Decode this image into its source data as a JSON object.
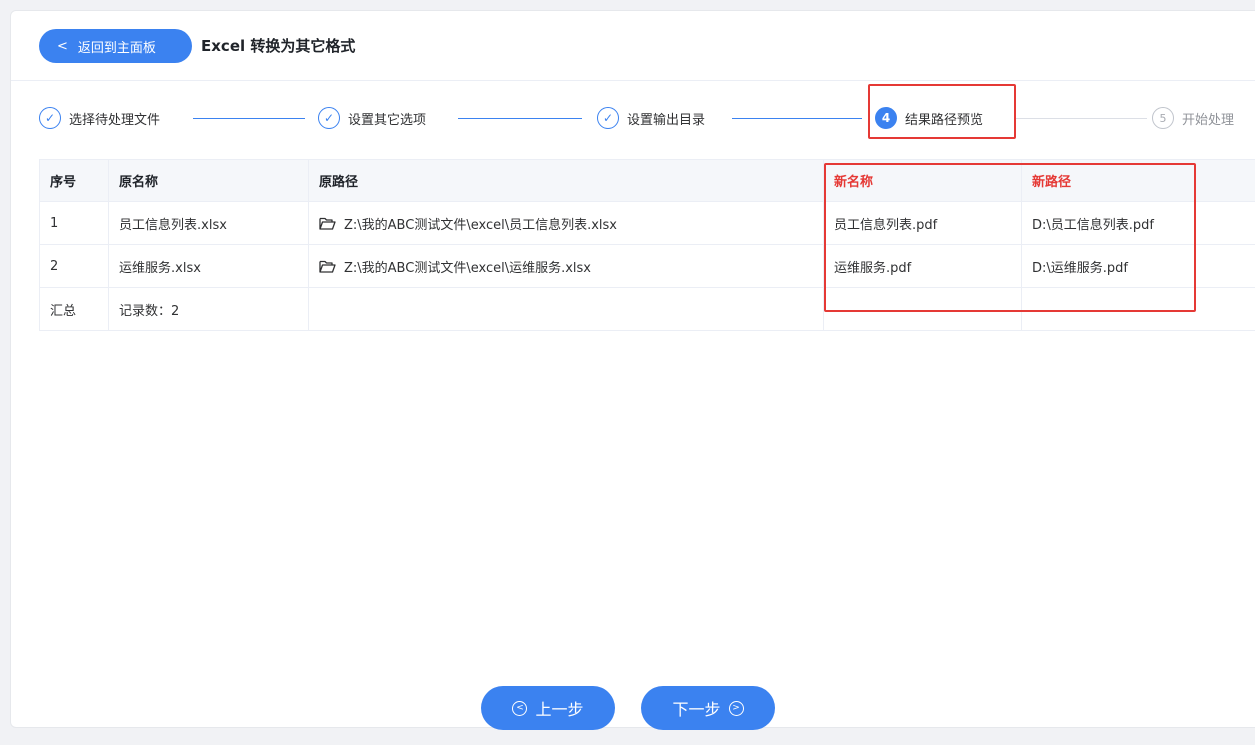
{
  "header": {
    "back_label": "返回到主面板",
    "title": "Excel 转换为其它格式"
  },
  "steps": [
    {
      "num": "✓",
      "label": "选择待处理文件",
      "state": "done"
    },
    {
      "num": "✓",
      "label": "设置其它选项",
      "state": "done"
    },
    {
      "num": "✓",
      "label": "设置输出目录",
      "state": "done"
    },
    {
      "num": "4",
      "label": "结果路径预览",
      "state": "active"
    },
    {
      "num": "5",
      "label": "开始处理",
      "state": "todo"
    }
  ],
  "table": {
    "columns": [
      "序号",
      "原名称",
      "原路径",
      "新名称",
      "新路径"
    ],
    "rows": [
      {
        "index": "1",
        "name": "员工信息列表.xlsx",
        "path": "Z:\\我的ABC测试文件\\excel\\员工信息列表.xlsx",
        "new_name": "员工信息列表.pdf",
        "new_path": "D:\\员工信息列表.pdf"
      },
      {
        "index": "2",
        "name": "运维服务.xlsx",
        "path": "Z:\\我的ABC测试文件\\excel\\运维服务.xlsx",
        "new_name": "运维服务.pdf",
        "new_path": "D:\\运维服务.pdf"
      }
    ],
    "summary": {
      "label": "汇总",
      "count_text": "记录数：2"
    }
  },
  "footer": {
    "prev_label": "上一步",
    "next_label": "下一步"
  },
  "colors": {
    "accent": "#3b82f0",
    "highlight": "#e53935"
  }
}
